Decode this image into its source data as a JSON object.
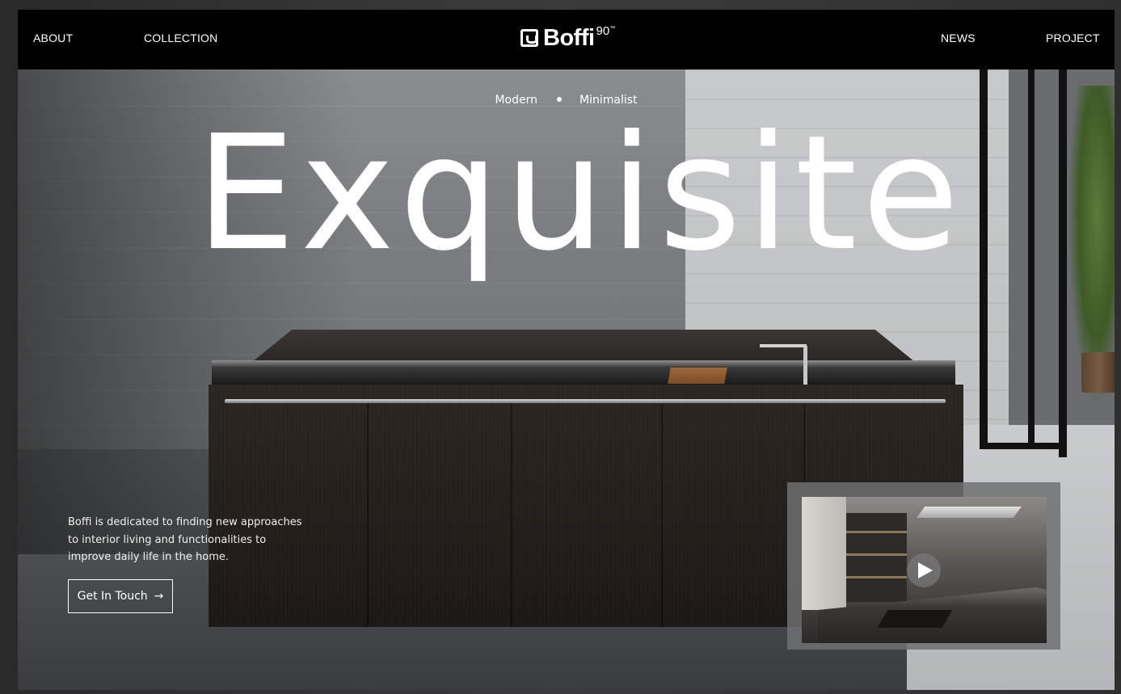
{
  "nav": {
    "about": "ABOUT",
    "collection": "COLLECTION",
    "news": "NEWS",
    "project": "PROJECT",
    "logo_text": "Boffi",
    "logo_sup": "90",
    "logo_tm": "™"
  },
  "hero": {
    "tag_left": "Modern",
    "tag_right": "Minimalist",
    "headline": "Exquisite",
    "description": "Boffi is dedicated to finding new approaches to interior living and functionalities to improve daily life in the home.",
    "cta_label": "Get In Touch",
    "cta_arrow": "→"
  },
  "video": {
    "play_icon": "play-icon"
  },
  "colors": {
    "nav_bg": "#000000",
    "text": "#ffffff",
    "frame": "#3a3a3a"
  }
}
